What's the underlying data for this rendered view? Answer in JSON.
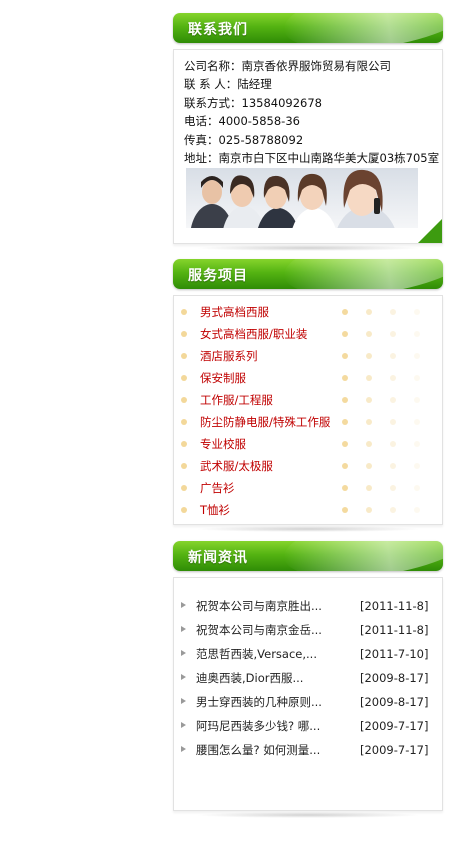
{
  "contact": {
    "title": "联系我们",
    "company_label": "公司名称：",
    "company": "南京香依界服饰贸易有限公司",
    "person_label": "联 系 人：",
    "person": "陆经理",
    "mobile_label": "联系方式：",
    "mobile": "13584092678",
    "phone_label": "电话：",
    "phone": "4000-5858-36",
    "fax_label": "传真：",
    "fax": "025-58788092",
    "address_label": "地址：",
    "address": "南京市白下区中山南路华美大厦03栋705室"
  },
  "services": {
    "title": "服务项目",
    "items": [
      "男式高档西服",
      "女式高档西服/职业装",
      "酒店服系列",
      "保安制服",
      "工作服/工程服",
      "防尘防静电服/特殊工作服",
      "专业校服",
      "武术服/太极服",
      "广告衫",
      "T恤衫"
    ]
  },
  "news": {
    "title": "新闻资讯",
    "items": [
      {
        "title": "祝贺本公司与南京胜出...",
        "date": "[2011-11-8]"
      },
      {
        "title": "祝贺本公司与南京金岳...",
        "date": "[2011-11-8]"
      },
      {
        "title": "范思哲西装,Versace,...",
        "date": "[2011-7-10]"
      },
      {
        "title": "迪奥西装,Dior西服...",
        "date": "[2009-8-17]"
      },
      {
        "title": "男士穿西装的几种原则...",
        "date": "[2009-8-17]"
      },
      {
        "title": "阿玛尼西装多少钱? 哪...",
        "date": "[2009-7-17]"
      },
      {
        "title": "腰围怎么量? 如何测量...",
        "date": "[2009-7-17]"
      }
    ]
  },
  "colors": {
    "header_green": "#4fae12",
    "service_link": "#c00000",
    "bullet": "#f3d89a"
  }
}
